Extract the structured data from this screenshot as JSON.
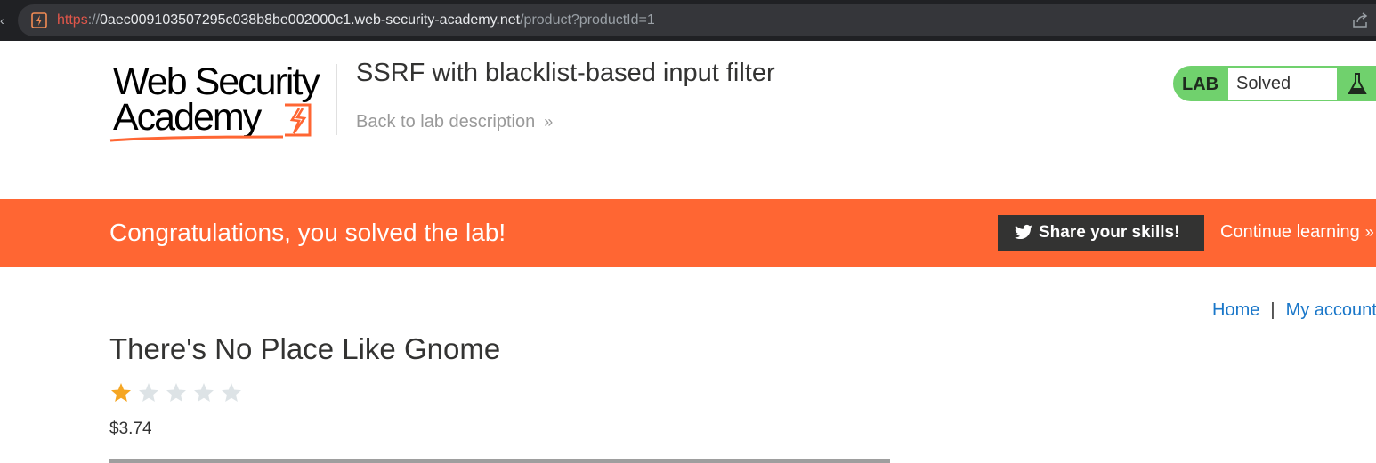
{
  "browser": {
    "url_protocol": "https",
    "url_separator": "://",
    "url_host": "0aec009103507295c038b8be002000c1.web-security-academy.net",
    "url_path": "/product?productId=1"
  },
  "header": {
    "logo_line1": "Web Security",
    "logo_line2": "Academy",
    "lab_title": "SSRF with blacklist-based input filter",
    "back_link": "Back to lab description",
    "lab_tag": "LAB",
    "lab_state": "Solved"
  },
  "banner": {
    "message": "Congratulations, you solved the lab!",
    "share_label": "Share your skills!",
    "continue_label": "Continue learning"
  },
  "nav": {
    "home": "Home",
    "separator": "|",
    "my_account": "My account"
  },
  "product": {
    "title": "There's No Place Like Gnome",
    "rating": 1,
    "rating_max": 5,
    "price": "$3.74"
  },
  "colors": {
    "accent_orange": "#ff6633",
    "lab_green": "#70d16d",
    "link_blue": "#1a77c9",
    "star_gold": "#f5a623",
    "star_empty": "#dde3e6"
  }
}
